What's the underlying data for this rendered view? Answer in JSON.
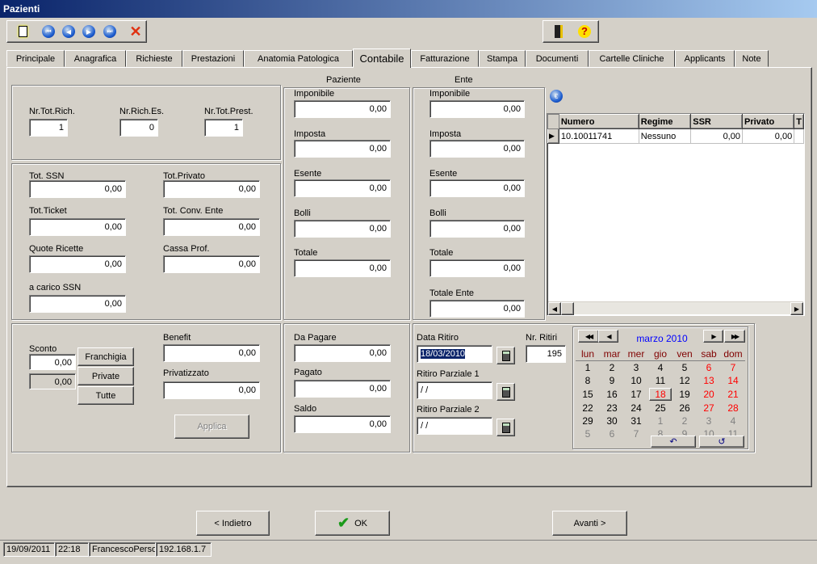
{
  "window": {
    "title": "Pazienti"
  },
  "toolbar": {
    "icons": [
      "new-document-icon",
      "first-record-icon",
      "previous-record-icon",
      "next-record-icon",
      "last-record-icon",
      "delete-icon",
      "exit-door-icon",
      "help-icon"
    ],
    "help": "?"
  },
  "tabs": [
    "Principale",
    "Anagrafica",
    "Richieste",
    "Prestazioni",
    "Anatomia Patologica",
    "Contabile",
    "Fatturazione",
    "Stampa",
    "Documenti",
    "Cartelle Cliniche",
    "Applicants",
    "Note"
  ],
  "active_tab": "Contabile",
  "headers": {
    "paziente": "Paziente",
    "ente": "Ente"
  },
  "fields": [
    {
      "id": "nr_tot_rich",
      "label": "Nr.Tot.Rich.",
      "value": "1"
    },
    {
      "id": "nr_rich_es",
      "label": "Nr.Rich.Es.",
      "value": "0"
    },
    {
      "id": "nr_tot_prest",
      "label": "Nr.Tot.Prest.",
      "value": "1"
    },
    {
      "id": "tot_ssn",
      "label": "Tot. SSN",
      "value": "0,00"
    },
    {
      "id": "tot_privato",
      "label": "Tot.Privato",
      "value": "0,00"
    },
    {
      "id": "tot_ticket",
      "label": "Tot.Ticket",
      "value": "0,00"
    },
    {
      "id": "tot_conv_ente",
      "label": "Tot. Conv. Ente",
      "value": "0,00"
    },
    {
      "id": "quote_ricette",
      "label": "Quote Ricette",
      "value": "0,00"
    },
    {
      "id": "cassa_prof",
      "label": "Cassa Prof.",
      "value": "0,00"
    },
    {
      "id": "a_carico_ssn",
      "label": "a carico SSN",
      "value": "0,00"
    },
    {
      "id": "paz_imponibile",
      "label": "Imponibile",
      "value": "0,00"
    },
    {
      "id": "paz_imposta",
      "label": "Imposta",
      "value": "0,00"
    },
    {
      "id": "paz_esente",
      "label": "Esente",
      "value": "0,00"
    },
    {
      "id": "paz_bolli",
      "label": "Bolli",
      "value": "0,00"
    },
    {
      "id": "paz_totale",
      "label": "Totale",
      "value": "0,00"
    },
    {
      "id": "ente_imponibile",
      "label": "Imponibile",
      "value": "0,00"
    },
    {
      "id": "ente_imposta",
      "label": "Imposta",
      "value": "0,00"
    },
    {
      "id": "ente_esente",
      "label": "Esente",
      "value": "0,00"
    },
    {
      "id": "ente_bolli",
      "label": "Bolli",
      "value": "0,00"
    },
    {
      "id": "ente_totale",
      "label": "Totale",
      "value": "0,00"
    },
    {
      "id": "ente_totale_ente",
      "label": "Totale Ente",
      "value": "0,00"
    },
    {
      "id": "sconto",
      "label": "Sconto",
      "value": "0,00"
    },
    {
      "id": "sconto_calc",
      "label": "",
      "value": "0,00"
    },
    {
      "id": "benefit",
      "label": "Benefit",
      "value": "0,00"
    },
    {
      "id": "privatizzato",
      "label": "Privatizzato",
      "value": "0,00"
    },
    {
      "id": "da_pagare",
      "label": "Da Pagare",
      "value": "0,00"
    },
    {
      "id": "pagato",
      "label": "Pagato",
      "value": "0,00"
    },
    {
      "id": "saldo",
      "label": "Saldo",
      "value": "0,00"
    },
    {
      "id": "data_ritiro",
      "label": "Data Ritiro",
      "value": "18/03/2010"
    },
    {
      "id": "nr_ritiri",
      "label": "Nr. Ritiri",
      "value": "195"
    },
    {
      "id": "ritiro_parziale_1",
      "label": "Ritiro Parziale 1",
      "value": " / /"
    },
    {
      "id": "ritiro_parziale_2",
      "label": "Ritiro Parziale 2",
      "value": " / /"
    }
  ],
  "buttons": {
    "franchigia": "Franchigia",
    "private": "Private",
    "tutte": "Tutte",
    "applica": "Applica",
    "indietro": "< Indietro",
    "ok": "OK",
    "avanti": "Avanti >"
  },
  "grid": {
    "columns": [
      "Numero",
      "Regime",
      "SSR",
      "Privato",
      "T"
    ],
    "rows": [
      [
        "10.10011741",
        "Nessuno",
        "0,00",
        "0,00",
        ""
      ]
    ]
  },
  "calendar": {
    "month": "marzo 2010",
    "weekdays": [
      "lun",
      "mar",
      "mer",
      "gio",
      "ven",
      "sab",
      "dom"
    ],
    "weeks": [
      [
        "1",
        "2",
        "3",
        "4",
        "5",
        "6",
        "7"
      ],
      [
        "8",
        "9",
        "10",
        "11",
        "12",
        "13",
        "14"
      ],
      [
        "15",
        "16",
        "17",
        "18",
        "19",
        "20",
        "21"
      ],
      [
        "22",
        "23",
        "24",
        "25",
        "26",
        "27",
        "28"
      ],
      [
        "29",
        "30",
        "31",
        "1",
        "2",
        "3",
        "4"
      ],
      [
        "5",
        "6",
        "7",
        "8",
        "9",
        "10",
        "11"
      ]
    ],
    "selected": "18",
    "colors": {
      "weekday_header": "#800000",
      "weekend": "#ff0000",
      "other_month": "#808080",
      "month": "#0000ff"
    }
  },
  "status": [
    "19/09/2011",
    "22:18",
    "FrancescoPerson",
    "192.168.1.7"
  ]
}
